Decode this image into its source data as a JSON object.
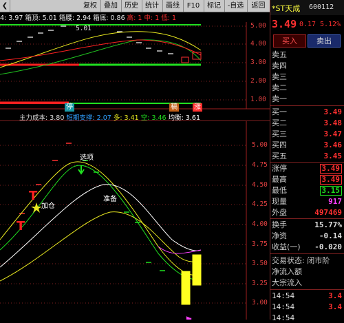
{
  "toolbar": {
    "back_glyph": "❮",
    "buttons": [
      "复权",
      "叠加",
      "历史",
      "统计",
      "画线",
      "F10",
      "标记",
      "-自选",
      "返回"
    ]
  },
  "top_panel": {
    "indicator_line": "4: 3.97  箱顶: 5.01  箱腰: 2.94  箱底: 0.86  高: 1  中: 1  低: 1",
    "parts": [
      {
        "text": "4: 3.97",
        "color": "#e8e8e8"
      },
      {
        "text": "箱顶: 5.01",
        "color": "#e8e8e8"
      },
      {
        "text": "箱腰: 2.94",
        "color": "#e8e8e8"
      },
      {
        "text": "箱底: 0.86",
        "color": "#e8e8e8"
      },
      {
        "text": "高: 1",
        "color": "#ff3030"
      },
      {
        "text": "中: 1",
        "color": "#ff3030"
      },
      {
        "text": "低: 1",
        "color": "#ff3030"
      }
    ],
    "box_top_label": "5.01",
    "y_ticks": [
      "5.00",
      "4.00",
      "3.00",
      "2.00",
      "1.00"
    ],
    "markers": [
      {
        "text": "停",
        "bg": "#1a9aa8"
      },
      {
        "text": "稿",
        "bg": "#c06018"
      },
      {
        "text": "涨",
        "bg": "#ff3030"
      }
    ]
  },
  "bottom_panel": {
    "legend": [
      {
        "text": "主力成本: 3.80",
        "color": "#dddddd"
      },
      {
        "text": "短期支撑: 2.07",
        "color": "#30a0ff"
      },
      {
        "text": "多: 3.41",
        "color": "#e8e820"
      },
      {
        "text": "空: 3.46",
        "color": "#20e020"
      },
      {
        "text": "均衡: 3.61",
        "color": "#ffffff"
      }
    ],
    "y_ticks": [
      "5.00",
      "4.75",
      "4.50",
      "4.25",
      "4.00",
      "3.75",
      "3.50",
      "3.25",
      "3.00"
    ],
    "annotations": {
      "xuanxiang": "选项",
      "jiacang": "加仓",
      "zhunbei": "准备"
    },
    "markers_T": [
      "T",
      "T"
    ]
  },
  "quote": {
    "name": "*ST天成",
    "code": "600112",
    "price": "3.49",
    "change": "0.17",
    "change_pct": "5.12%",
    "buy_label": "买入",
    "sell_label": "卖出"
  },
  "order_book": {
    "asks": [
      {
        "label": "卖五",
        "price": "",
        "vol": ""
      },
      {
        "label": "卖四",
        "price": "",
        "vol": ""
      },
      {
        "label": "卖三",
        "price": "",
        "vol": ""
      },
      {
        "label": "卖二",
        "price": "",
        "vol": ""
      },
      {
        "label": "卖一",
        "price": "",
        "vol": ""
      }
    ],
    "bids": [
      {
        "label": "买一",
        "price": "3.49",
        "vol": ""
      },
      {
        "label": "买二",
        "price": "3.48",
        "vol": ""
      },
      {
        "label": "买三",
        "price": "3.47",
        "vol": ""
      },
      {
        "label": "买四",
        "price": "3.46",
        "vol": ""
      },
      {
        "label": "买五",
        "price": "3.45",
        "vol": ""
      }
    ]
  },
  "stats": [
    {
      "label": "涨停",
      "value": "3.49",
      "color": "#ff3030",
      "boxed": true
    },
    {
      "label": "最高",
      "value": "3.49",
      "color": "#ff3030",
      "boxed": true
    },
    {
      "label": "最低",
      "value": "3.15",
      "color": "#20e020",
      "boxed": true
    },
    {
      "label": "现量",
      "value": "917",
      "color": "#ff40ff",
      "boxed": false
    },
    {
      "label": "外盘",
      "value": "497469",
      "color": "#ff3030",
      "boxed": false
    }
  ],
  "stats2": [
    {
      "label": "换手",
      "value": "15.77%",
      "color": "#dddddd"
    },
    {
      "label": "净资",
      "value": "-0.14",
      "color": "#dddddd"
    },
    {
      "label": "收益(一)",
      "value": "-0.020",
      "color": "#dddddd"
    }
  ],
  "status": {
    "trade_state": "交易状态: 闭市阶",
    "net_inflow": "净流入额",
    "block_inflow": "大宗流入"
  },
  "ticks": [
    {
      "time": "14:54",
      "price": "3.4"
    },
    {
      "time": "14:54",
      "price": "3.4"
    },
    {
      "time": "14:54",
      "price": ""
    }
  ],
  "colors": {
    "up": "#ff3030",
    "down": "#20e020",
    "bg": "#000000"
  }
}
